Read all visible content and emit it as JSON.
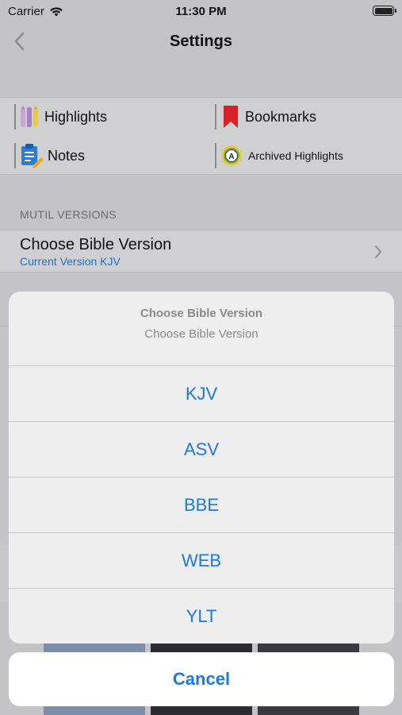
{
  "status_bar": {
    "carrier": "Carrier",
    "time": "11:30 PM"
  },
  "nav": {
    "title": "Settings"
  },
  "quick_links": {
    "highlights": "Highlights",
    "bookmarks": "Bookmarks",
    "notes": "Notes",
    "archived_highlights": "Archived Highlights"
  },
  "versions_section": {
    "header": "MUTIL VERSIONS",
    "row_title": "Choose Bible Version",
    "row_subtitle": "Current Version KJV"
  },
  "action_sheet": {
    "title": "Choose Bible Version",
    "message": "Choose Bible Version",
    "options": [
      "KJV",
      "ASV",
      "BBE",
      "WEB",
      "YLT"
    ],
    "cancel": "Cancel"
  },
  "colors": {
    "accent": "#1a7ae0",
    "bookmark": "#d8202a",
    "dim_background": "#c4c4c6"
  }
}
